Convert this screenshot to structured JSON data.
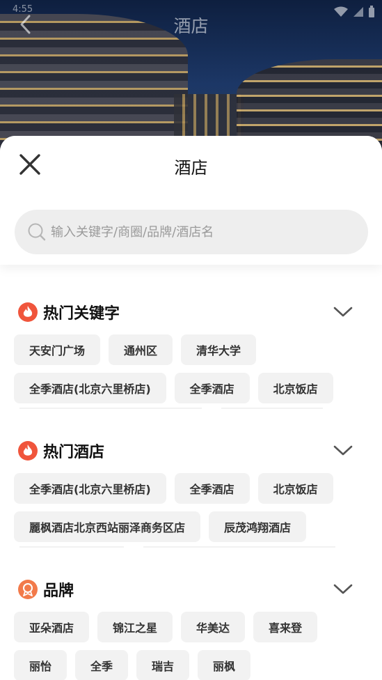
{
  "colors": {
    "accent": "#f0553c",
    "brand_icon": "#f27a4a",
    "tag_bg": "#f2f2f2",
    "search_bg": "#eeeeee"
  },
  "status_bar": {
    "time": "4:55"
  },
  "hero": {
    "title": "酒店"
  },
  "sheet": {
    "title": "酒店",
    "search": {
      "placeholder": "输入关键字/商圈/品牌/酒店名",
      "value": ""
    }
  },
  "sections": [
    {
      "title": "热门关键字",
      "icon": "fire-icon",
      "tags": [
        "天安门广场",
        "通州区",
        "清华大学",
        "全季酒店(北京六里桥店)",
        "全季酒店",
        "北京饭店"
      ]
    },
    {
      "title": "热门酒店",
      "icon": "fire-icon",
      "tags": [
        "全季酒店(北京六里桥店)",
        "全季酒店",
        "北京饭店",
        "麗枫酒店北京西站丽泽商务区店",
        "辰茂鸿翔酒店"
      ]
    },
    {
      "title": "品牌",
      "icon": "medal-icon",
      "tags": [
        "亚朵酒店",
        "锦江之星",
        "华美达",
        "喜来登",
        "丽怡",
        "全季",
        "瑞吉",
        "丽枫"
      ]
    }
  ]
}
